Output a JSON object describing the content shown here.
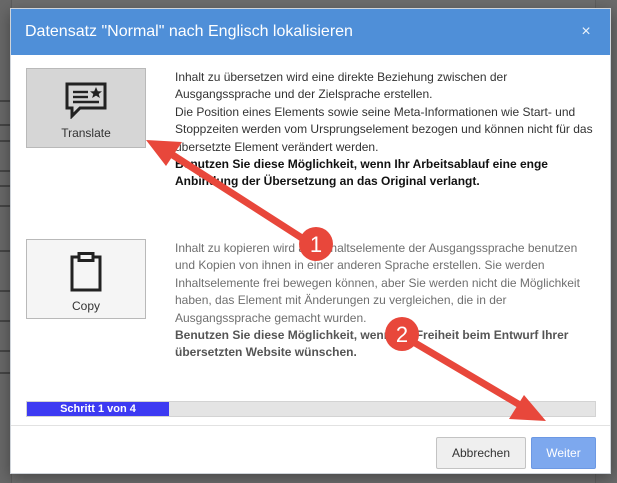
{
  "modal": {
    "title": "Datensatz \"Normal\" nach Englisch lokalisieren",
    "close_symbol": "×"
  },
  "options": {
    "translate": {
      "label": "Translate",
      "icon": "speech-bubble-star-icon",
      "description": "Inhalt zu übersetzen wird eine direkte Beziehung zwischen der Ausgangssprache und der Zielsprache erstellen.",
      "description2": "Die Position eines Elements sowie seine Meta-Informationen wie Start- und Stoppzeiten werden vom Ursprungselement bezogen und können nicht für das übersetzte Element verändert werden.",
      "emphasis": "Benutzen Sie diese Möglichkeit, wenn Ihr Arbeitsablauf eine enge Anbindung der Übersetzung an das Original verlangt."
    },
    "copy": {
      "label": "Copy",
      "icon": "clipboard-icon",
      "description": "Inhalt zu kopieren wird alle Inhaltselemente der Ausgangssprache benutzen und Kopien von ihnen in einer anderen Sprache erstellen. Sie werden Inhaltselemente frei bewegen können, aber Sie werden nicht die Möglichkeit haben, das Element mit Änderungen zu vergleichen, die in der Ausgangssprache gemacht wurden.",
      "emphasis": "Benutzen Sie diese Möglichkeit, wenn Sie Freiheit beim Entwurf Ihrer übersetzten Website wünschen."
    }
  },
  "progress": {
    "label": "Schritt 1 von 4",
    "fraction": 0.25
  },
  "buttons": {
    "cancel": "Abbrechen",
    "next": "Weiter"
  },
  "annotations": {
    "marker1": "1",
    "marker2": "2"
  },
  "colors": {
    "header": "#4f8fd8",
    "progress_fill": "#3d3af2",
    "next_button": "#7da8ee",
    "arrow": "#e8473b"
  }
}
